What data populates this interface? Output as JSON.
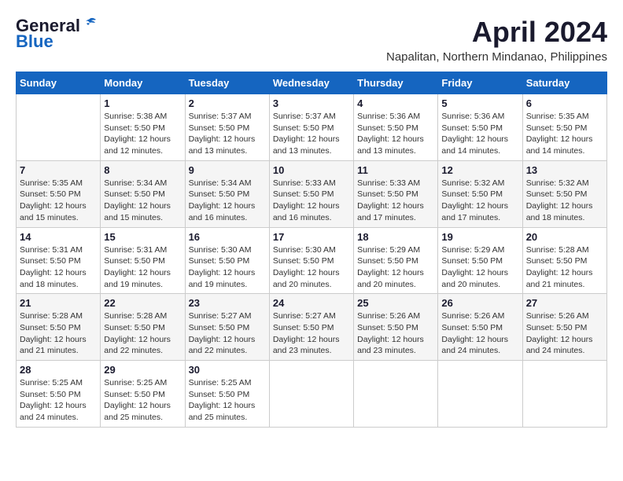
{
  "header": {
    "logo_line1": "General",
    "logo_line2": "Blue",
    "month": "April 2024",
    "location": "Napalitan, Northern Mindanao, Philippines"
  },
  "weekdays": [
    "Sunday",
    "Monday",
    "Tuesday",
    "Wednesday",
    "Thursday",
    "Friday",
    "Saturday"
  ],
  "weeks": [
    [
      {
        "day": "",
        "info": ""
      },
      {
        "day": "1",
        "info": "Sunrise: 5:38 AM\nSunset: 5:50 PM\nDaylight: 12 hours\nand 12 minutes."
      },
      {
        "day": "2",
        "info": "Sunrise: 5:37 AM\nSunset: 5:50 PM\nDaylight: 12 hours\nand 13 minutes."
      },
      {
        "day": "3",
        "info": "Sunrise: 5:37 AM\nSunset: 5:50 PM\nDaylight: 12 hours\nand 13 minutes."
      },
      {
        "day": "4",
        "info": "Sunrise: 5:36 AM\nSunset: 5:50 PM\nDaylight: 12 hours\nand 13 minutes."
      },
      {
        "day": "5",
        "info": "Sunrise: 5:36 AM\nSunset: 5:50 PM\nDaylight: 12 hours\nand 14 minutes."
      },
      {
        "day": "6",
        "info": "Sunrise: 5:35 AM\nSunset: 5:50 PM\nDaylight: 12 hours\nand 14 minutes."
      }
    ],
    [
      {
        "day": "7",
        "info": "Sunrise: 5:35 AM\nSunset: 5:50 PM\nDaylight: 12 hours\nand 15 minutes."
      },
      {
        "day": "8",
        "info": "Sunrise: 5:34 AM\nSunset: 5:50 PM\nDaylight: 12 hours\nand 15 minutes."
      },
      {
        "day": "9",
        "info": "Sunrise: 5:34 AM\nSunset: 5:50 PM\nDaylight: 12 hours\nand 16 minutes."
      },
      {
        "day": "10",
        "info": "Sunrise: 5:33 AM\nSunset: 5:50 PM\nDaylight: 12 hours\nand 16 minutes."
      },
      {
        "day": "11",
        "info": "Sunrise: 5:33 AM\nSunset: 5:50 PM\nDaylight: 12 hours\nand 17 minutes."
      },
      {
        "day": "12",
        "info": "Sunrise: 5:32 AM\nSunset: 5:50 PM\nDaylight: 12 hours\nand 17 minutes."
      },
      {
        "day": "13",
        "info": "Sunrise: 5:32 AM\nSunset: 5:50 PM\nDaylight: 12 hours\nand 18 minutes."
      }
    ],
    [
      {
        "day": "14",
        "info": "Sunrise: 5:31 AM\nSunset: 5:50 PM\nDaylight: 12 hours\nand 18 minutes."
      },
      {
        "day": "15",
        "info": "Sunrise: 5:31 AM\nSunset: 5:50 PM\nDaylight: 12 hours\nand 19 minutes."
      },
      {
        "day": "16",
        "info": "Sunrise: 5:30 AM\nSunset: 5:50 PM\nDaylight: 12 hours\nand 19 minutes."
      },
      {
        "day": "17",
        "info": "Sunrise: 5:30 AM\nSunset: 5:50 PM\nDaylight: 12 hours\nand 20 minutes."
      },
      {
        "day": "18",
        "info": "Sunrise: 5:29 AM\nSunset: 5:50 PM\nDaylight: 12 hours\nand 20 minutes."
      },
      {
        "day": "19",
        "info": "Sunrise: 5:29 AM\nSunset: 5:50 PM\nDaylight: 12 hours\nand 20 minutes."
      },
      {
        "day": "20",
        "info": "Sunrise: 5:28 AM\nSunset: 5:50 PM\nDaylight: 12 hours\nand 21 minutes."
      }
    ],
    [
      {
        "day": "21",
        "info": "Sunrise: 5:28 AM\nSunset: 5:50 PM\nDaylight: 12 hours\nand 21 minutes."
      },
      {
        "day": "22",
        "info": "Sunrise: 5:28 AM\nSunset: 5:50 PM\nDaylight: 12 hours\nand 22 minutes."
      },
      {
        "day": "23",
        "info": "Sunrise: 5:27 AM\nSunset: 5:50 PM\nDaylight: 12 hours\nand 22 minutes."
      },
      {
        "day": "24",
        "info": "Sunrise: 5:27 AM\nSunset: 5:50 PM\nDaylight: 12 hours\nand 23 minutes."
      },
      {
        "day": "25",
        "info": "Sunrise: 5:26 AM\nSunset: 5:50 PM\nDaylight: 12 hours\nand 23 minutes."
      },
      {
        "day": "26",
        "info": "Sunrise: 5:26 AM\nSunset: 5:50 PM\nDaylight: 12 hours\nand 24 minutes."
      },
      {
        "day": "27",
        "info": "Sunrise: 5:26 AM\nSunset: 5:50 PM\nDaylight: 12 hours\nand 24 minutes."
      }
    ],
    [
      {
        "day": "28",
        "info": "Sunrise: 5:25 AM\nSunset: 5:50 PM\nDaylight: 12 hours\nand 24 minutes."
      },
      {
        "day": "29",
        "info": "Sunrise: 5:25 AM\nSunset: 5:50 PM\nDaylight: 12 hours\nand 25 minutes."
      },
      {
        "day": "30",
        "info": "Sunrise: 5:25 AM\nSunset: 5:50 PM\nDaylight: 12 hours\nand 25 minutes."
      },
      {
        "day": "",
        "info": ""
      },
      {
        "day": "",
        "info": ""
      },
      {
        "day": "",
        "info": ""
      },
      {
        "day": "",
        "info": ""
      }
    ]
  ]
}
